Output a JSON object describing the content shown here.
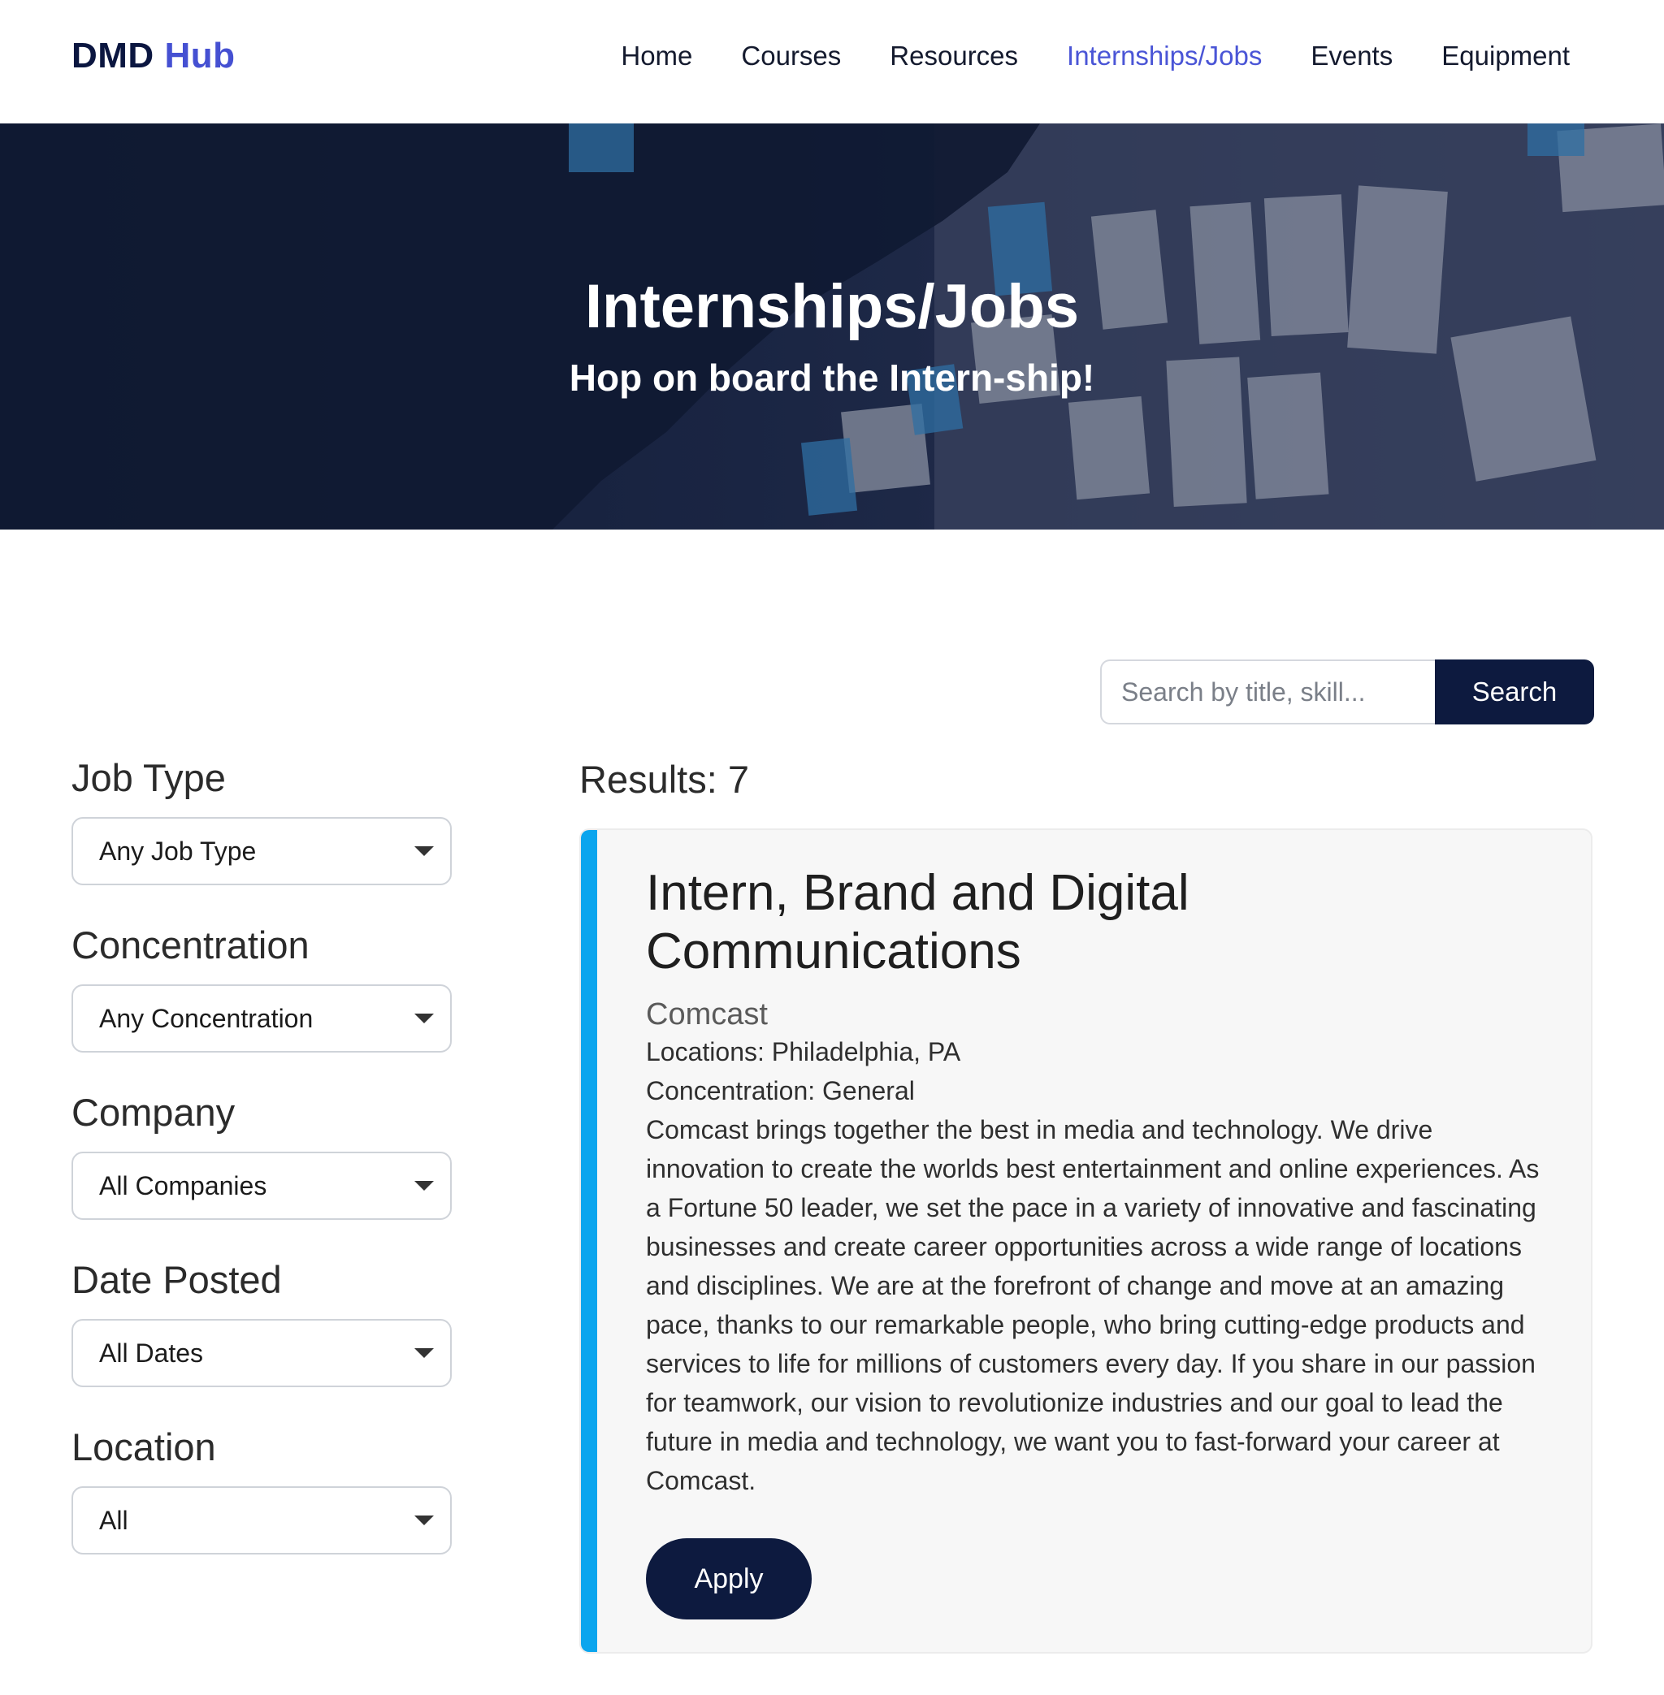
{
  "brand": {
    "part1": "DMD",
    "part2": "Hub"
  },
  "nav": {
    "items": [
      {
        "label": "Home"
      },
      {
        "label": "Courses"
      },
      {
        "label": "Resources"
      },
      {
        "label": "Internships/Jobs"
      },
      {
        "label": "Events"
      },
      {
        "label": "Equipment"
      }
    ],
    "active": "Internships/Jobs"
  },
  "hero": {
    "title": "Internships/Jobs",
    "subtitle": "Hop on board the Intern-ship!"
  },
  "search": {
    "placeholder": "Search by title, skill...",
    "button_label": "Search"
  },
  "filters": [
    {
      "label": "Job Type",
      "selected": "Any Job Type"
    },
    {
      "label": "Concentration",
      "selected": "Any Concentration"
    },
    {
      "label": "Company",
      "selected": "All Companies"
    },
    {
      "label": "Date Posted",
      "selected": "All Dates"
    },
    {
      "label": "Location",
      "selected": "All"
    }
  ],
  "results": {
    "count_text": "Results: 7",
    "jobs": [
      {
        "title": "Intern, Brand and Digital Communications",
        "company": "Comcast",
        "locations": "Locations: Philadelphia, PA",
        "concentration": "Concentration: General",
        "description": "Comcast brings together the best in media and technology. We drive innovation to create the worlds best entertainment and online experiences. As a Fortune 50 leader, we set the pace in a variety of innovative and fascinating businesses and create career opportunities across a wide range of locations and disciplines. We are at the forefront of change and move at an amazing pace, thanks to our remarkable people, who bring cutting-edge products and services to life for millions of customers every day. If you share in our passion for teamwork, our vision to revolutionize industries and our goal to lead the future in media and technology, we want you to fast-forward your career at Comcast.",
        "apply_label": "Apply"
      }
    ]
  },
  "colors": {
    "navy": "#0d1a3f",
    "brand_blue": "#4550d2",
    "accent_cyan": "#0aa5ee"
  }
}
